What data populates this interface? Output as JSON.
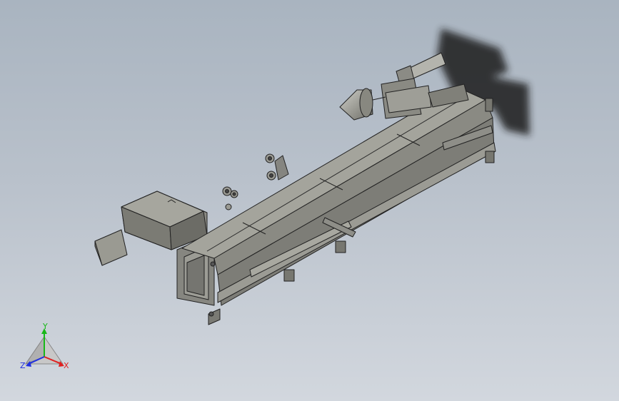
{
  "viewport": {
    "background_top": "#a9b4c0",
    "background_bottom": "#d2d7de",
    "model_fill": "#8f8f87",
    "model_face_light": "#a2a29a",
    "model_face_dark": "#6f6f68",
    "edge_color": "#202020",
    "shadow_color": "#1e1e1e"
  },
  "triad": {
    "x_label": "X",
    "y_label": "Y",
    "z_label": "Z",
    "x_color": "#e02020",
    "y_color": "#18b818",
    "z_color": "#2030e0"
  }
}
